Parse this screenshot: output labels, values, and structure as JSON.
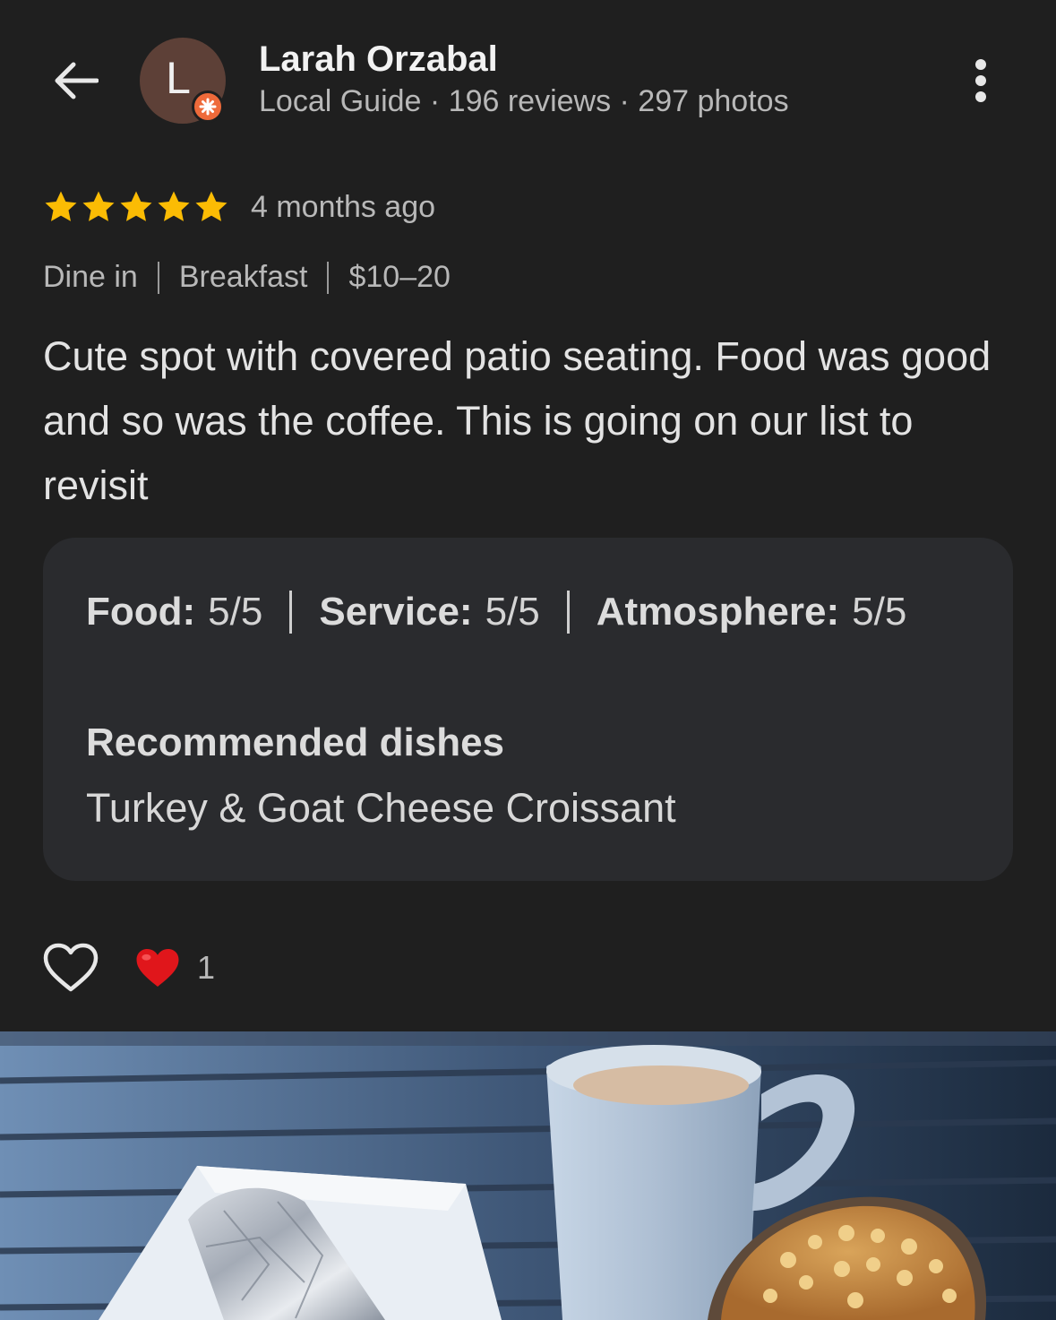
{
  "header": {
    "avatar_letter": "L",
    "user_name": "Larah Orzabal",
    "user_meta": "Local Guide · 196 reviews · 297 photos"
  },
  "review": {
    "star_rating": 5,
    "time_ago": "4 months ago",
    "tags": [
      "Dine in",
      "Breakfast",
      "$10–20"
    ],
    "text": "Cute spot with covered patio seating. Food was good and so was the coffee. This is going on our list to revisit"
  },
  "details": {
    "food_label": "Food:",
    "food_value": "5/5",
    "service_label": "Service:",
    "service_value": "5/5",
    "atmosphere_label": "Atmosphere:",
    "atmosphere_value": "5/5",
    "recommended_title": "Recommended dishes",
    "recommended_dish": "Turkey & Goat Cheese Croissant"
  },
  "reactions": {
    "heart_count": "1"
  },
  "icons": {
    "back": "back-arrow-icon",
    "more": "more-vert-icon",
    "badge": "local-guide-badge-icon",
    "star": "star-icon",
    "like": "heart-outline-icon",
    "reaction": "red-heart-icon"
  },
  "colors": {
    "background": "#1f1f1f",
    "card": "#2a2b2e",
    "star": "#fbbc04",
    "avatar": "#5d4037",
    "badge": "#ee6a3a",
    "heart": "#e0161b"
  }
}
